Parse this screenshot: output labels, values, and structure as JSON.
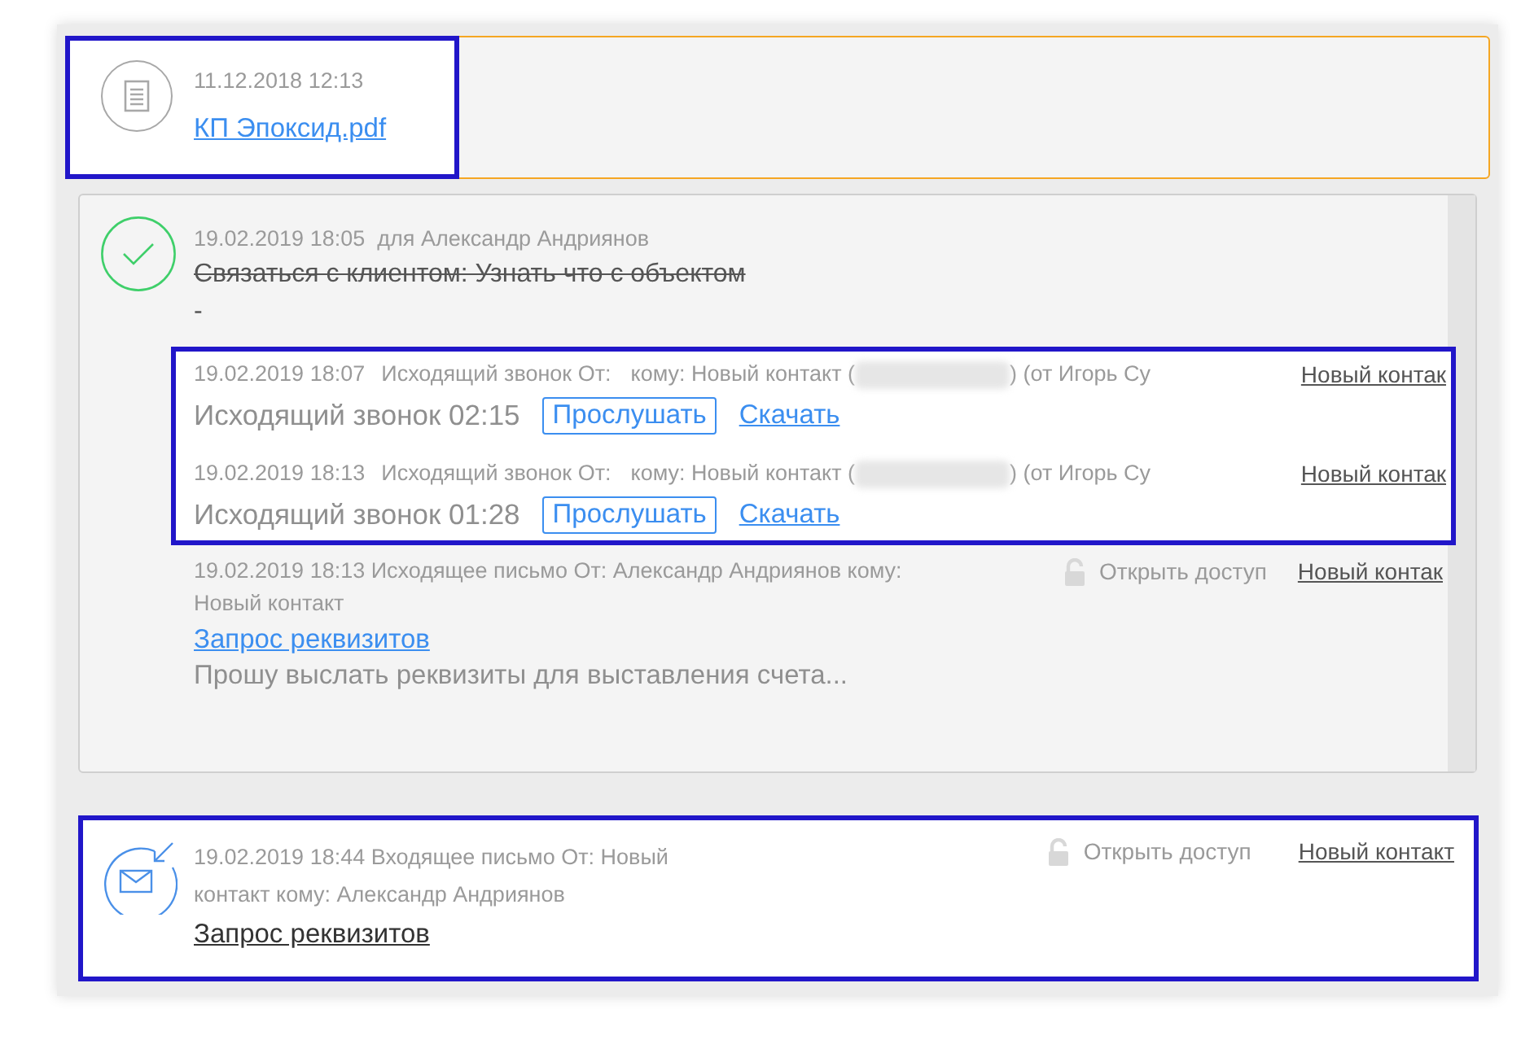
{
  "file_event": {
    "highlighted": true,
    "datetime": "11.12.2018 12:13",
    "file_name": "КП Эпоксид.pdf"
  },
  "task": {
    "done": true,
    "datetime": "19.02.2019 18:05",
    "assignee": "для Александр Андриянов",
    "title": "Связаться с клиентом: Узнать что с объектом",
    "note": "-",
    "calls_highlighted": true,
    "calls": [
      {
        "datetime": "19.02.2019 18:07",
        "direction": "Исходящий звонок От:",
        "recipient": "кому: Новый контакт (",
        "caller": ") (от Игорь Су",
        "contact_link": "Новый контак",
        "summary": "Исходящий звонок 02:15",
        "listen_button": "Прослушать",
        "download_link": "Скачать"
      },
      {
        "datetime": "19.02.2019 18:13",
        "direction": "Исходящий звонок От:",
        "recipient": "кому: Новый контакт (",
        "caller": ") (от Игорь Су",
        "contact_link": "Новый контак",
        "summary": "Исходящий звонок 01:28",
        "listen_button": "Прослушать",
        "download_link": "Скачать"
      }
    ],
    "email": {
      "meta": "19.02.2019 18:13 Исходящее письмо От: Александр Андриянов кому: Новый контакт",
      "access": "Открыть доступ",
      "contact_link": "Новый контак",
      "subject": "Запрос реквизитов",
      "preview": "Прошу выслать реквизиты для выставления счета..."
    }
  },
  "incoming_email": {
    "highlighted": true,
    "meta": "19.02.2019 18:44 Входящее письмо От: Новый контакт кому: Александр Андриянов",
    "access": "Открыть доступ",
    "contact_link": "Новый контакт",
    "subject": "Запрос реквизитов"
  }
}
